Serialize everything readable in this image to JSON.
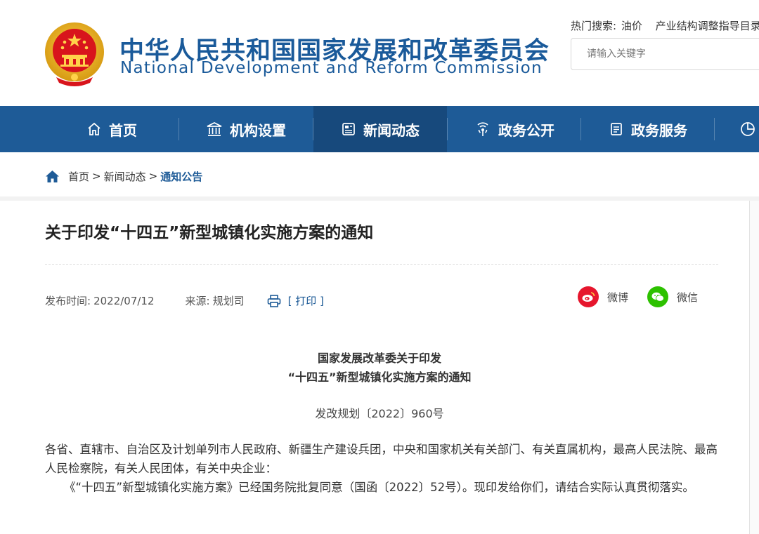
{
  "header": {
    "title_cn": "中华人民共和国国家发展和改革委员会",
    "title_en": "National Development and Reform Commission",
    "hot_label": "热门搜索:",
    "hot_terms": [
      "油价",
      "产业结构调整指导目录"
    ],
    "search_placeholder": "请输入关键字"
  },
  "nav": {
    "items": [
      {
        "label": "首页",
        "icon": "home-icon"
      },
      {
        "label": "机构设置",
        "icon": "institution-icon"
      },
      {
        "label": "新闻动态",
        "icon": "news-icon"
      },
      {
        "label": "政务公开",
        "icon": "broadcast-icon"
      },
      {
        "label": "政务服务",
        "icon": "service-icon"
      }
    ],
    "active_index": 2
  },
  "breadcrumb": {
    "home": "首页",
    "sep": ">",
    "section": "新闻动态",
    "current": "通知公告"
  },
  "article": {
    "title": "关于印发“十四五”新型城镇化实施方案的通知",
    "published_label": "发布时间:",
    "published": "2022/07/12",
    "source_label": "来源:",
    "source": "规划司",
    "print_label": "[ 打印 ]",
    "share": [
      {
        "label": "微博",
        "icon": "weibo-icon",
        "color": "#e6162d"
      },
      {
        "label": "微信",
        "icon": "wechat-icon",
        "color": "#2dc100"
      }
    ],
    "doc_heading_1": "国家发展改革委关于印发",
    "doc_heading_2": "“十四五”新型城镇化实施方案的通知",
    "doc_number": "发改规划〔2022〕960号",
    "para_1": "各省、直辖市、自治区及计划单列市人民政府、新疆生产建设兵团，中央和国家机关有关部门、有关直属机构，最高人民法院、最高人民检察院，有关人民团体，有关中央企业：",
    "para_2": "《“十四五”新型城镇化实施方案》已经国务院批复同意（国函〔2022〕52号）。现印发给你们，请结合实际认真贯彻落实。"
  },
  "colors": {
    "brand_blue": "#1e5b97",
    "nav_active": "#17497c"
  }
}
